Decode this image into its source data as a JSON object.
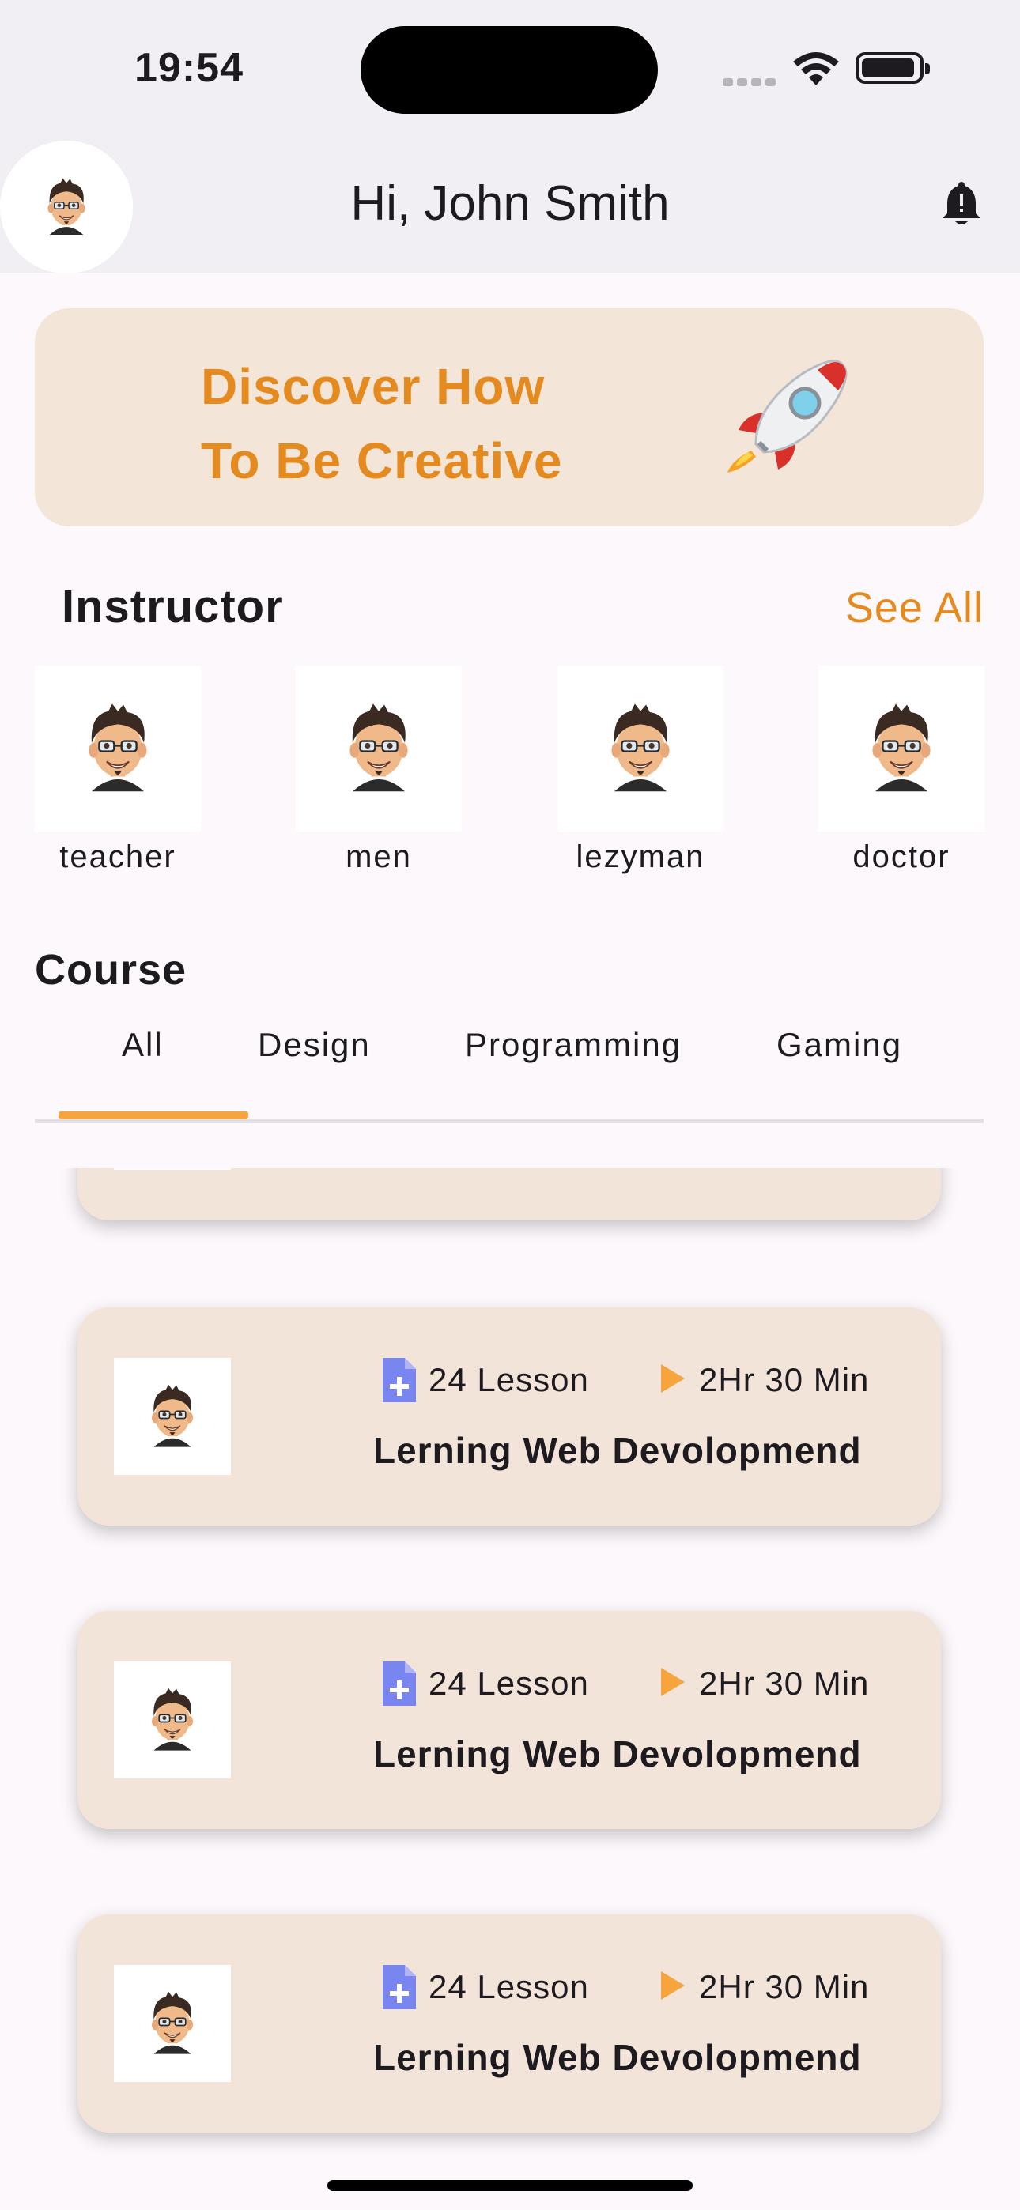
{
  "status_bar": {
    "time": "19:54"
  },
  "header": {
    "greeting": "Hi, John Smith"
  },
  "banner": {
    "line1": "Discover How",
    "line2": "To Be Creative"
  },
  "instructors": {
    "title": "Instructor",
    "see_all": "See All",
    "items": [
      {
        "name": "teacher"
      },
      {
        "name": "men"
      },
      {
        "name": "lezyman"
      },
      {
        "name": "doctor"
      }
    ]
  },
  "course": {
    "title": "Course",
    "tabs": [
      {
        "label": "All",
        "selected": true
      },
      {
        "label": "Design",
        "selected": false
      },
      {
        "label": "Programming",
        "selected": false
      },
      {
        "label": "Gaming",
        "selected": false
      }
    ],
    "cards": [
      {
        "lessons": "24 Lesson",
        "duration": "2Hr 30 Min",
        "name": "Lerning Web Devolopmend"
      },
      {
        "lessons": "24 Lesson",
        "duration": "2Hr 30 Min",
        "name": "Lerning Web Devolopmend"
      },
      {
        "lessons": "24 Lesson",
        "duration": "2Hr 30 Min",
        "name": "Lerning Web Devolopmend"
      }
    ]
  },
  "colors": {
    "accent": "#e58a1f",
    "tab_indicator": "#f7a43c",
    "card_bg": "#f2e4d8",
    "banner_bg": "#f3e5d7",
    "doc_icon": "#7a86f0"
  }
}
